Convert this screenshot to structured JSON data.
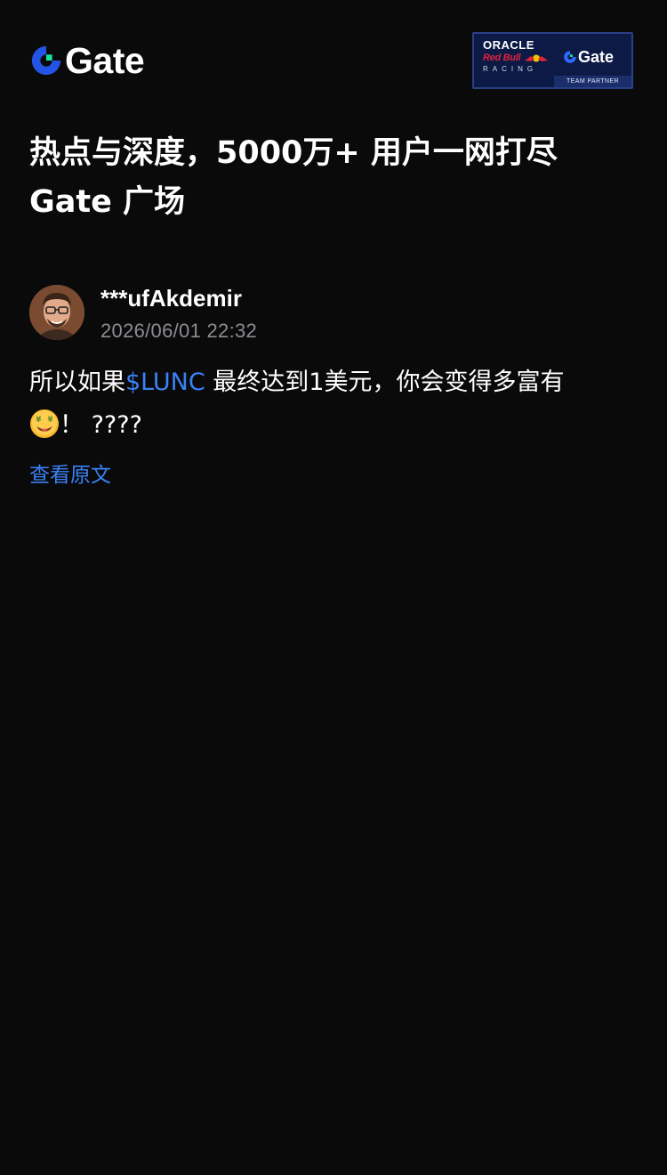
{
  "header": {
    "logo_text": "Gate",
    "partner": {
      "oracle": "ORACLE",
      "redbull": "Red Bull",
      "racing": "RACING",
      "gate": "Gate",
      "tag": "TEAM PARTNER"
    }
  },
  "headline": {
    "line1": "热点与深度，5000万+ 用户一网打尽",
    "line2": "Gate 广场"
  },
  "post": {
    "username": "***ufAkdemir",
    "time": "2026/06/01 22:32",
    "text_before": "所以如果",
    "ticker": "$LUNC",
    "text_after": " 最终达到1美元，你会变得多富有",
    "emoji": "money-mouth-face",
    "text_tail": "！ ????",
    "view_original": "查看原文"
  },
  "colors": {
    "background": "#0a0a0b",
    "accent_blue": "#3a82f6",
    "muted_text": "#8b8d93",
    "logo_blue": "#2354e6",
    "logo_green": "#17e6a1"
  }
}
